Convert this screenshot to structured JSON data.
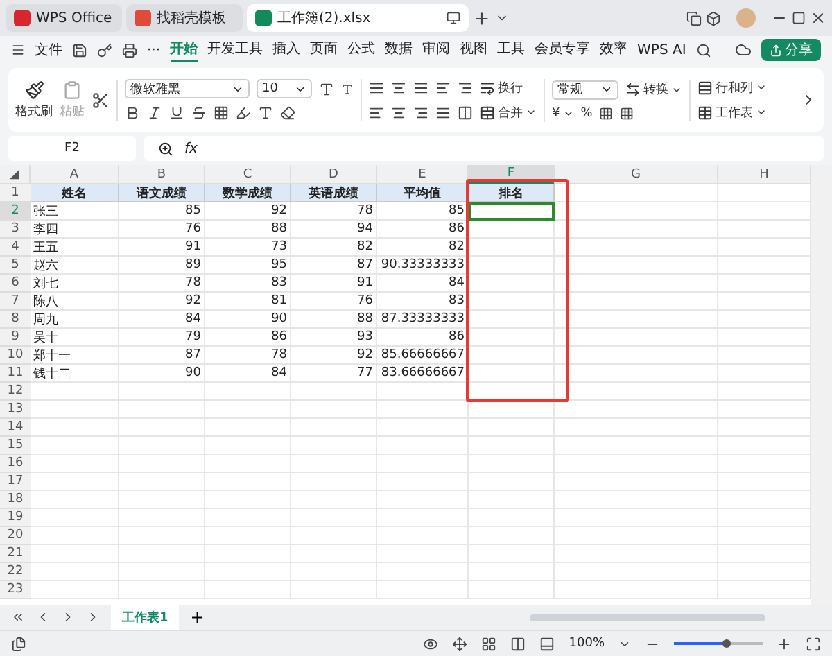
{
  "app_tabs": [
    {
      "label": "WPS Office",
      "kind": "home",
      "selected": false
    },
    {
      "label": "找稻壳模板",
      "kind": "template",
      "selected": false
    },
    {
      "label": "工作簿(2).xlsx",
      "kind": "sheet",
      "selected": true
    }
  ],
  "menu": {
    "file": "文件",
    "more": "···",
    "items": [
      {
        "label": "开始",
        "selected": true
      },
      {
        "label": "开发工具",
        "selected": false
      },
      {
        "label": "插入",
        "selected": false
      },
      {
        "label": "页面",
        "selected": false
      },
      {
        "label": "公式",
        "selected": false
      },
      {
        "label": "数据",
        "selected": false
      },
      {
        "label": "审阅",
        "selected": false
      },
      {
        "label": "视图",
        "selected": false
      },
      {
        "label": "工具",
        "selected": false
      },
      {
        "label": "会员专享",
        "selected": false
      },
      {
        "label": "效率",
        "selected": false
      }
    ],
    "ai": "WPS AI",
    "share": "分享"
  },
  "ribbon": {
    "format_painter": "格式刷",
    "paste": "粘贴",
    "font": "微软雅黑",
    "size": "10",
    "wrap": "换行",
    "merge": "合并",
    "number_format": "常规",
    "convert": "转换",
    "currency": "¥",
    "percent": "%",
    "rows_cols": "行和列",
    "worksheet": "工作表"
  },
  "name_box": "F2",
  "fx": "fx",
  "corner": "◢",
  "columns": [
    {
      "letter": "A",
      "selected": false,
      "highlighted": false
    },
    {
      "letter": "B",
      "selected": false,
      "highlighted": false
    },
    {
      "letter": "C",
      "selected": false,
      "highlighted": false
    },
    {
      "letter": "D",
      "selected": false,
      "highlighted": false
    },
    {
      "letter": "E",
      "selected": false,
      "highlighted": false
    },
    {
      "letter": "F",
      "selected": true,
      "highlighted": true
    },
    {
      "letter": "G",
      "selected": false,
      "highlighted": false
    },
    {
      "letter": "H",
      "selected": false,
      "highlighted": false
    }
  ],
  "header_row": [
    "姓名",
    "语文成绩",
    "数学成绩",
    "英语成绩",
    "平均值",
    "排名"
  ],
  "rows": [
    {
      "number": "2",
      "selected": true,
      "cells": [
        "张三",
        "85",
        "92",
        "78",
        "85"
      ]
    },
    {
      "number": "3",
      "selected": false,
      "cells": [
        "李四",
        "76",
        "88",
        "94",
        "86"
      ]
    },
    {
      "number": "4",
      "selected": false,
      "cells": [
        "王五",
        "91",
        "73",
        "82",
        "82"
      ]
    },
    {
      "number": "5",
      "selected": false,
      "cells": [
        "赵六",
        "89",
        "95",
        "87",
        "90.33333333"
      ]
    },
    {
      "number": "6",
      "selected": false,
      "cells": [
        "刘七",
        "78",
        "83",
        "91",
        "84"
      ]
    },
    {
      "number": "7",
      "selected": false,
      "cells": [
        "陈八",
        "92",
        "81",
        "76",
        "83"
      ]
    },
    {
      "number": "8",
      "selected": false,
      "cells": [
        "周九",
        "84",
        "90",
        "88",
        "87.33333333"
      ]
    },
    {
      "number": "9",
      "selected": false,
      "cells": [
        "吴十",
        "79",
        "86",
        "93",
        "86"
      ]
    },
    {
      "number": "10",
      "selected": false,
      "cells": [
        "郑十一",
        "87",
        "78",
        "92",
        "85.66666667"
      ]
    },
    {
      "number": "11",
      "selected": false,
      "cells": [
        "钱十二",
        "90",
        "84",
        "77",
        "83.66666667"
      ]
    }
  ],
  "header_row_number": "1",
  "empty_rows": [
    "12",
    "13",
    "14",
    "15",
    "16",
    "17",
    "18",
    "19",
    "20",
    "21",
    "22",
    "23"
  ],
  "sheet_tabs": [
    {
      "label": "工作表1",
      "selected": true
    }
  ],
  "add_sheet": "+",
  "status": {
    "zoom": "100%",
    "zoom_slider": {
      "level": 0.6
    }
  }
}
